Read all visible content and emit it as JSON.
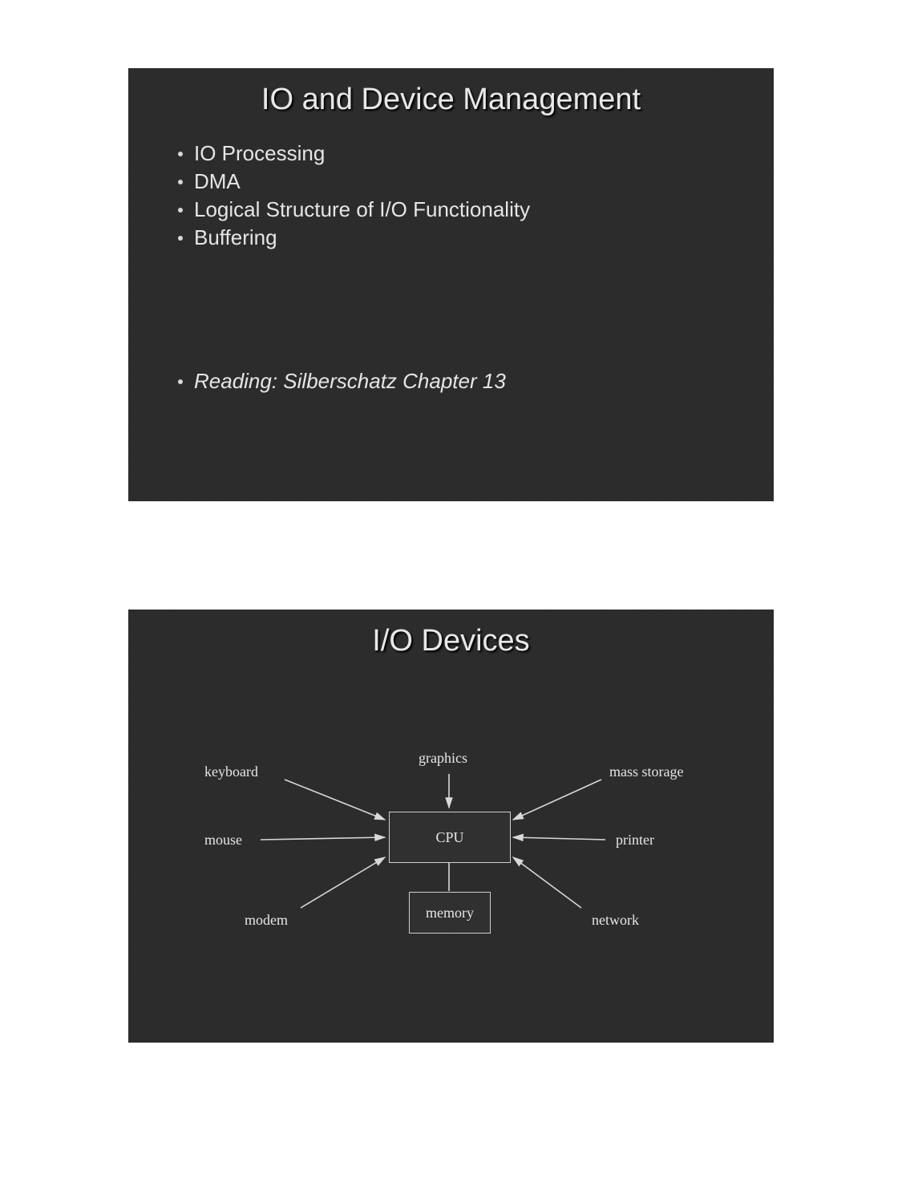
{
  "slide1": {
    "title": "IO and Device Management",
    "bullets": [
      "IO Processing",
      "DMA",
      "Logical Structure of I/O Functionality",
      "Buffering"
    ],
    "reading": "Reading: Silberschatz Chapter 13"
  },
  "slide2": {
    "title": "I/O Devices",
    "diagram": {
      "cpu": "CPU",
      "memory": "memory",
      "labels": {
        "keyboard": "keyboard",
        "mouse": "mouse",
        "modem": "modem",
        "graphics": "graphics",
        "mass_storage": "mass storage",
        "printer": "printer",
        "network": "network"
      }
    }
  }
}
